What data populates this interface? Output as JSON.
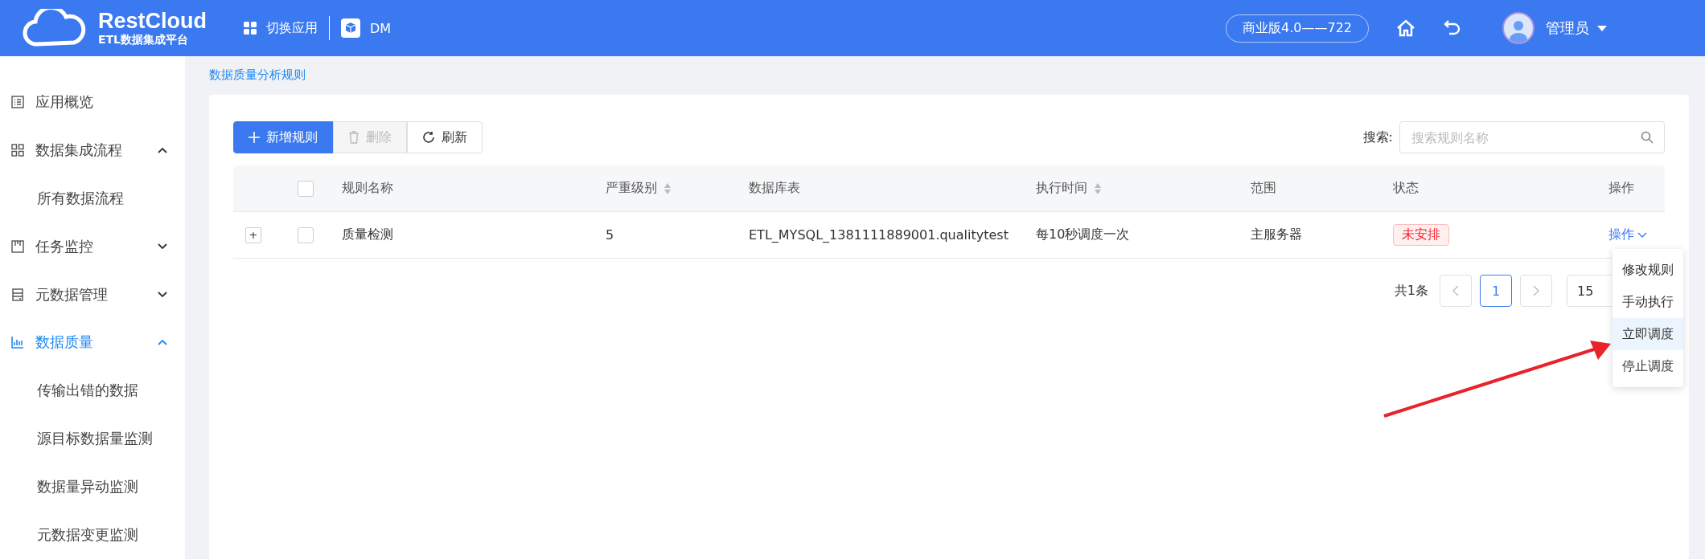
{
  "header": {
    "logo": {
      "name": "RestCloud",
      "subtitle": "ETL数据集成平台"
    },
    "switch_app": "切换应用",
    "app": "DM",
    "version": "商业版4.0——722",
    "user": "管理员"
  },
  "sidebar": {
    "items": [
      {
        "label": "应用概览",
        "selected": false
      },
      {
        "label": "数据集成流程",
        "selected": false,
        "expanded": true,
        "children": [
          {
            "label": "所有数据流程",
            "selected": false
          }
        ]
      },
      {
        "label": "任务监控",
        "selected": false,
        "expanded": false
      },
      {
        "label": "元数据管理",
        "selected": false,
        "expanded": false
      },
      {
        "label": "数据质量",
        "selected": true,
        "expanded": true,
        "children": [
          {
            "label": "传输出错的数据",
            "selected": false
          },
          {
            "label": "源目标数据量监测",
            "selected": false
          },
          {
            "label": "数据量异动监测",
            "selected": false
          },
          {
            "label": "元数据变更监测",
            "selected": false
          }
        ]
      }
    ]
  },
  "breadcrumb": "数据质量分析规则",
  "toolbar": {
    "buttons": [
      {
        "label": "新增规则",
        "kind": "add",
        "disabled": false
      },
      {
        "label": "删除",
        "kind": "delete",
        "disabled": true
      },
      {
        "label": "刷新",
        "kind": "refresh",
        "disabled": false
      }
    ]
  },
  "search": {
    "label": "搜索:",
    "placeholder": "搜索规则名称"
  },
  "table": {
    "select_all_checked": false,
    "columns": [
      {
        "label": "规则名称",
        "sortable": false
      },
      {
        "label": "严重级别",
        "sortable": true
      },
      {
        "label": "数据库表",
        "sortable": false
      },
      {
        "label": "执行时间",
        "sortable": true
      },
      {
        "label": "范围",
        "sortable": false
      },
      {
        "label": "状态",
        "sortable": false
      },
      {
        "label": "操作",
        "sortable": false
      }
    ],
    "rows": [
      {
        "expander": "+",
        "checked": false,
        "name": "质量检测",
        "severity": "5",
        "table": "ETL_MYSQL_1381111889001.qualitytest",
        "schedule": "每10秒调度一次",
        "scope": "主服务器",
        "status": {
          "label": "未安排",
          "kind": "danger"
        },
        "action": "操作"
      }
    ]
  },
  "action_menu": {
    "items": [
      {
        "label": "修改规则",
        "selected": false
      },
      {
        "label": "手动执行",
        "selected": false
      },
      {
        "label": "立即调度",
        "selected": true
      },
      {
        "label": "停止调度",
        "selected": false
      }
    ]
  },
  "pagination": {
    "total": "共1条",
    "pages": [
      {
        "label": "1",
        "selected": true
      }
    ],
    "page_size": "15"
  }
}
